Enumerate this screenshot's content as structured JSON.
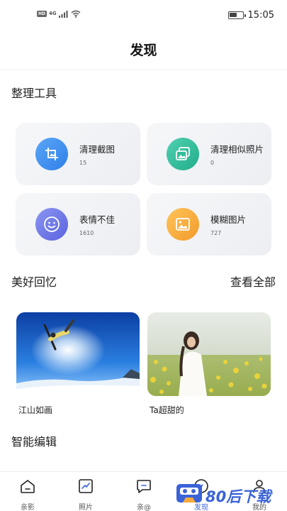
{
  "status_bar": {
    "time": "15:05",
    "network": "4G",
    "hd": "HD",
    "battery_level": 0.6
  },
  "header": {
    "title": "发现"
  },
  "tools_section": {
    "title": "整理工具",
    "items": [
      {
        "name": "清理截图",
        "count": "15",
        "icon": "crop-icon",
        "color": "#3d8ef0"
      },
      {
        "name": "清理相似照片",
        "count": "0",
        "icon": "similar-photos-icon",
        "color": "#2fbf9b"
      },
      {
        "name": "表情不佳",
        "count": "1610",
        "icon": "smiley-icon",
        "color": "#6b77e8"
      },
      {
        "name": "模糊图片",
        "count": "727",
        "icon": "blurry-image-icon",
        "color": "#f5a93a"
      }
    ]
  },
  "memories_section": {
    "title": "美好回忆",
    "see_all": "查看全部",
    "items": [
      {
        "label": "江山如画",
        "image": "snowboarder-photo"
      },
      {
        "label": "Ta超甜的",
        "image": "girl-in-flower-field-photo"
      }
    ]
  },
  "smart_edit_section": {
    "title": "智能编辑"
  },
  "tab_bar": {
    "items": [
      {
        "label": "亲影",
        "icon": "home-icon"
      },
      {
        "label": "照片",
        "icon": "photo-chart-icon"
      },
      {
        "label": "亲@",
        "icon": "chat-icon"
      },
      {
        "label": "发现",
        "icon": "discover-icon"
      },
      {
        "label": "我的",
        "icon": "profile-icon"
      }
    ],
    "active_color": "#3a63d8"
  },
  "watermark": {
    "text": "80后下载"
  }
}
